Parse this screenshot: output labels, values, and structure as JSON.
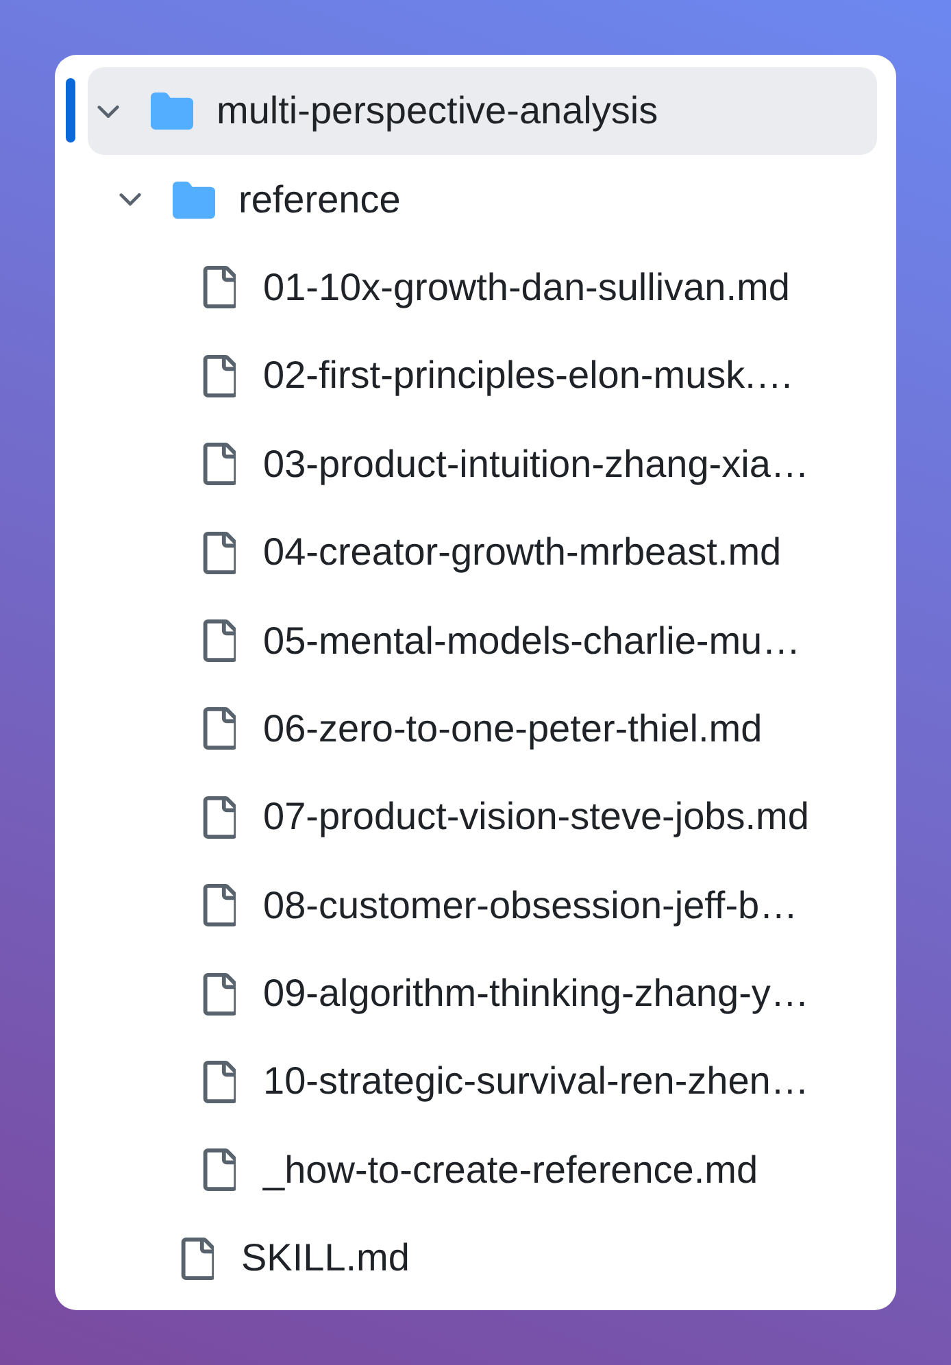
{
  "tree": [
    {
      "kind": "folder",
      "name": "multi-perspective-analysis",
      "selected": true,
      "expanded": true,
      "children": [
        {
          "kind": "folder",
          "name": "reference",
          "selected": false,
          "expanded": true,
          "children": [
            {
              "kind": "file",
              "name": "01-10x-growth-dan-sullivan.md",
              "selected": false
            },
            {
              "kind": "file",
              "name": "02-first-principles-elon-musk.…",
              "selected": false
            },
            {
              "kind": "file",
              "name": "03-product-intuition-zhang-xia…",
              "selected": false
            },
            {
              "kind": "file",
              "name": "04-creator-growth-mrbeast.md",
              "selected": false
            },
            {
              "kind": "file",
              "name": "05-mental-models-charlie-mu…",
              "selected": false
            },
            {
              "kind": "file",
              "name": "06-zero-to-one-peter-thiel.md",
              "selected": false
            },
            {
              "kind": "file",
              "name": "07-product-vision-steve-jobs.md",
              "selected": false
            },
            {
              "kind": "file",
              "name": "08-customer-obsession-jeff-b…",
              "selected": false
            },
            {
              "kind": "file",
              "name": "09-algorithm-thinking-zhang-y…",
              "selected": false
            },
            {
              "kind": "file",
              "name": "10-strategic-survival-ren-zhen…",
              "selected": false
            },
            {
              "kind": "file",
              "name": "_how-to-create-reference.md",
              "selected": false
            }
          ]
        },
        {
          "kind": "file",
          "name": "SKILL.md",
          "selected": false
        }
      ]
    }
  ]
}
